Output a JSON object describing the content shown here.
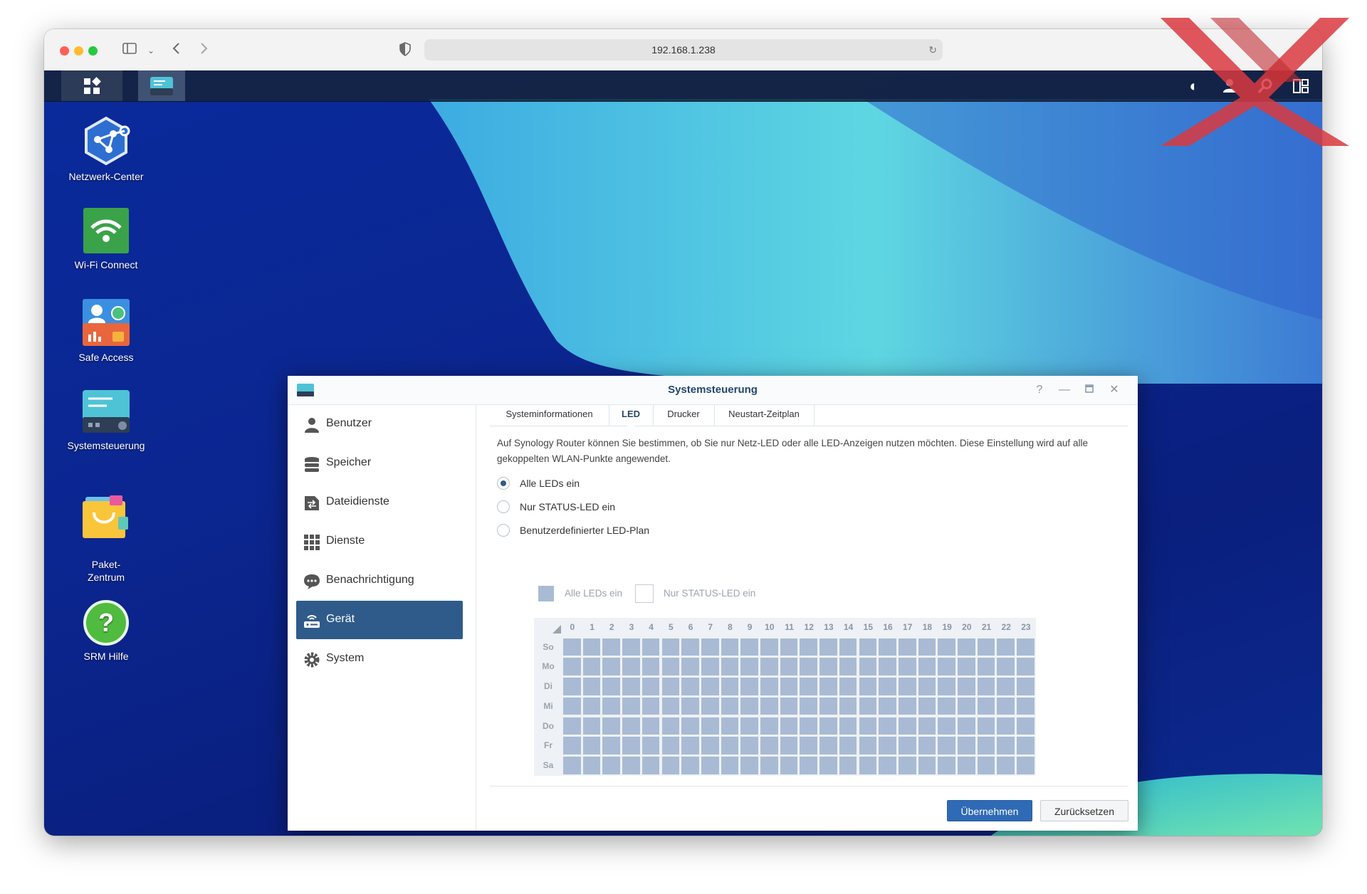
{
  "browser": {
    "url": "192.168.1.238"
  },
  "desktop_icons": [
    {
      "label": "Netzwerk-Center",
      "icon": "network-center-icon"
    },
    {
      "label": "Wi-Fi Connect",
      "icon": "wifi-connect-icon"
    },
    {
      "label": "Safe Access",
      "icon": "safe-access-icon"
    },
    {
      "label": "Systemsteuerung",
      "icon": "control-panel-icon"
    },
    {
      "label": "Paket-\nZentrum",
      "icon": "package-center-icon"
    },
    {
      "label": "SRM Hilfe",
      "icon": "help-icon"
    }
  ],
  "window": {
    "title": "Systemsteuerung",
    "sidebar": [
      {
        "label": "Benutzer",
        "icon": "user-icon"
      },
      {
        "label": "Speicher",
        "icon": "storage-icon"
      },
      {
        "label": "Dateidienste",
        "icon": "file-services-icon"
      },
      {
        "label": "Dienste",
        "icon": "services-grid-icon"
      },
      {
        "label": "Benachrichtigung",
        "icon": "notification-icon"
      },
      {
        "label": "Gerät",
        "icon": "router-device-icon",
        "active": true
      },
      {
        "label": "System",
        "icon": "system-gear-icon"
      }
    ],
    "tabs": [
      {
        "label": "Systeminformationen"
      },
      {
        "label": "LED",
        "active": true
      },
      {
        "label": "Drucker"
      },
      {
        "label": "Neustart-Zeitplan"
      }
    ],
    "description": "Auf Synology Router können Sie bestimmen, ob Sie nur Netz-LED oder alle LED-Anzeigen nutzen möchten. Diese Einstellung wird auf alle gekoppelten WLAN-Punkte angewendet.",
    "options": [
      {
        "label": "Alle LEDs ein",
        "selected": true
      },
      {
        "label": "Nur STATUS-LED ein",
        "selected": false
      },
      {
        "label": "Benutzerdefinierter LED-Plan",
        "selected": false
      }
    ],
    "legend": {
      "all_on": "Alle LEDs ein",
      "status_only": "Nur STATUS-LED ein"
    },
    "schedule": {
      "hours": [
        "0",
        "1",
        "2",
        "3",
        "4",
        "5",
        "6",
        "7",
        "8",
        "9",
        "10",
        "11",
        "12",
        "13",
        "14",
        "15",
        "16",
        "17",
        "18",
        "19",
        "20",
        "21",
        "22",
        "23"
      ],
      "days": [
        "So",
        "Mo",
        "Di",
        "Mi",
        "Do",
        "Fr",
        "Sa"
      ]
    },
    "buttons": {
      "apply": "Übernehmen",
      "reset": "Zurücksetzen"
    }
  },
  "colors": {
    "accent": "#2f5b8a",
    "primary_button": "#2f6ab6",
    "schedule_cell": "#a9bbd4"
  }
}
